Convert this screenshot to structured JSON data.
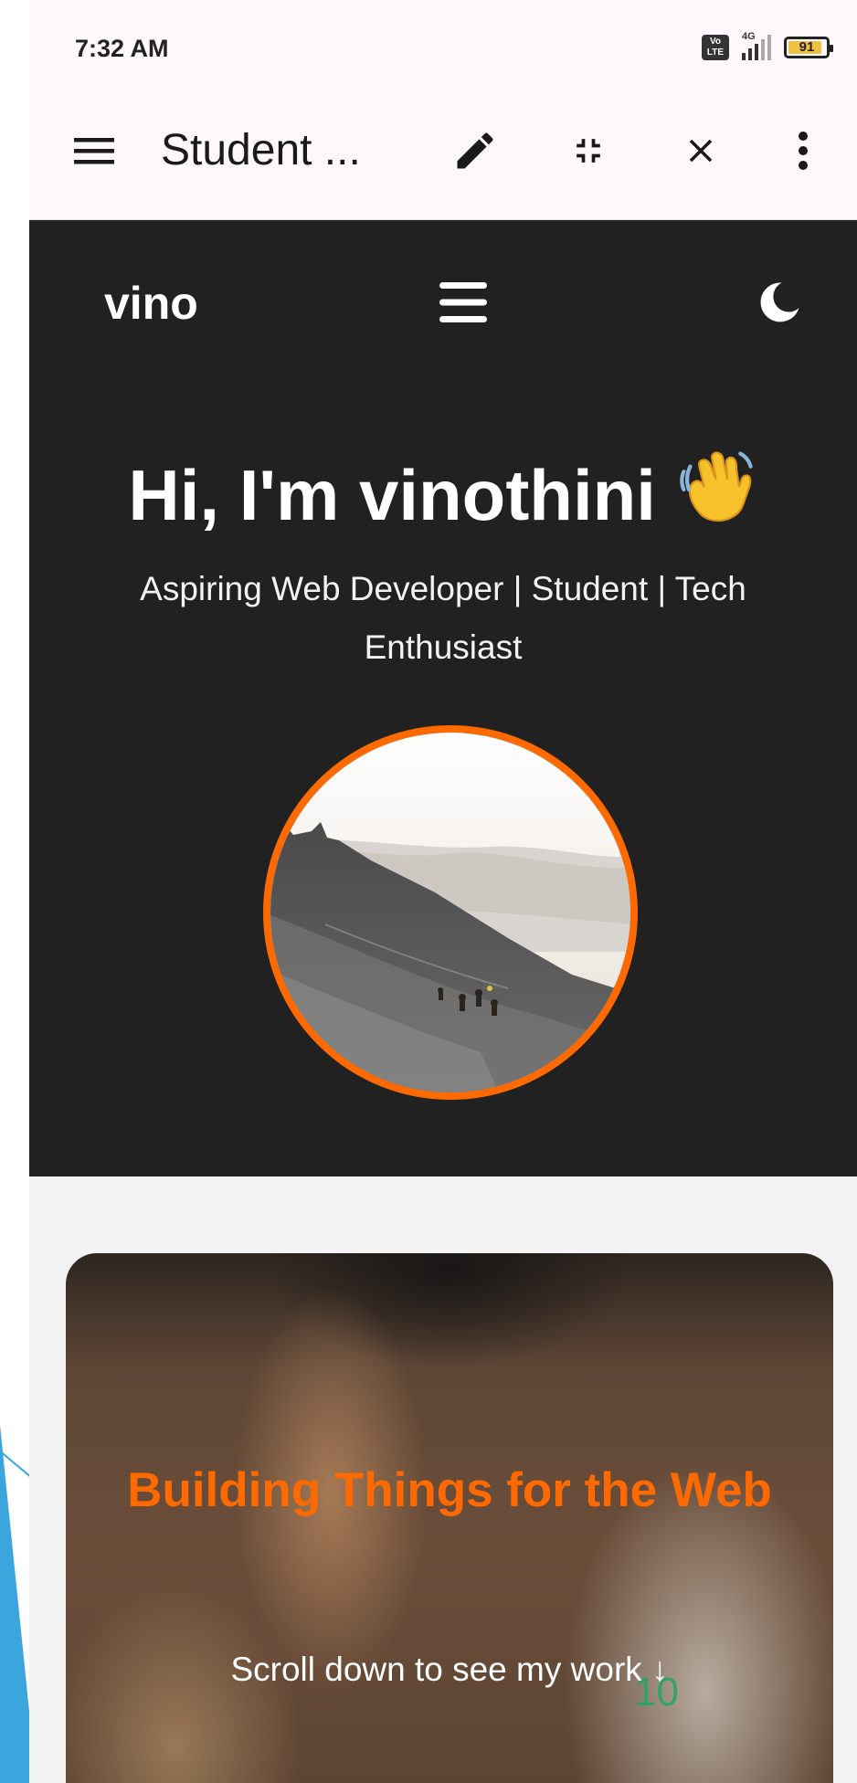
{
  "status_bar": {
    "time": "7:32 AM",
    "volte_label": "Vo LTE",
    "network_label": "4G",
    "battery_level": 91,
    "battery_text": "91"
  },
  "app_bar": {
    "title": "Student ...",
    "icons": [
      "menu-icon",
      "edit-icon",
      "collapse-icon",
      "close-icon",
      "more-vertical-icon"
    ]
  },
  "site": {
    "brand": "vino",
    "nav_icon": "hamburger-icon",
    "theme_icon": "moon-icon",
    "hero": {
      "heading": "Hi, I'm vinothini",
      "heading_emoji": "waving-hand-icon",
      "subtitle": "Aspiring Web Developer | Student | Tech Enthusiast",
      "avatar": "profile-photo"
    },
    "card": {
      "title": "Building Things for the Web",
      "subtitle": "Scroll down to see my work ↓",
      "badge": "10"
    }
  },
  "colors": {
    "accent": "#ff6a00",
    "header_bg": "#212121",
    "page_bg": "#f4f4f4",
    "status_bg": "#fdf8fc"
  }
}
